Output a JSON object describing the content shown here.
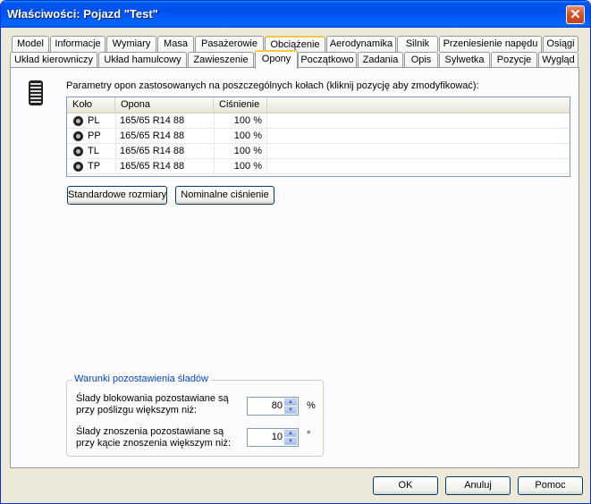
{
  "window": {
    "title": "Właściwości: Pojazd \"Test\"",
    "close_label": "✕"
  },
  "tabs_row1": [
    "Model",
    "Informacje",
    "Wymiary",
    "Masa",
    "Pasażerowie",
    "Obciążenie",
    "Aerodynamika",
    "Silnik",
    "Przeniesienie napędu",
    "Osiągi"
  ],
  "tabs_row2": [
    "Układ kierowniczy",
    "Układ hamulcowy",
    "Zawieszenie",
    "Opony",
    "Początkowo",
    "Zadania",
    "Opis",
    "Sylwetka",
    "Pozycje",
    "Wygląd"
  ],
  "active_tab": "Opony",
  "tires": {
    "hint": "Parametry opon zastosowanych na poszczególnych kołach (kliknij pozycję aby zmodyfikować):",
    "columns": [
      "Koło",
      "Opona",
      "Ciśnienie"
    ],
    "rows": [
      {
        "wheel": "PL",
        "tire": "165/65 R14 88",
        "pressure": "100 %"
      },
      {
        "wheel": "PP",
        "tire": "165/65 R14 88",
        "pressure": "100 %"
      },
      {
        "wheel": "TL",
        "tire": "165/65 R14 88",
        "pressure": "100 %"
      },
      {
        "wheel": "TP",
        "tire": "165/65 R14 88",
        "pressure": "100 %"
      }
    ],
    "btn_standard": "Standardowe rozmiary",
    "btn_nominal": "Nominalne ciśnienie"
  },
  "traces": {
    "title": "Warunki pozostawienia śladów",
    "blocking_label_1": "Ślady blokowania pozostawiane są",
    "blocking_label_2": "przy poślizgu większym niż:",
    "blocking_value": "80",
    "blocking_unit": "%",
    "wear_label_1": "Ślady znoszenia pozostawiane są",
    "wear_label_2": "przy kącie znoszenia większym niż:",
    "wear_value": "10",
    "wear_unit": "°"
  },
  "footer": {
    "ok": "OK",
    "cancel": "Anuluj",
    "help": "Pomoc"
  }
}
